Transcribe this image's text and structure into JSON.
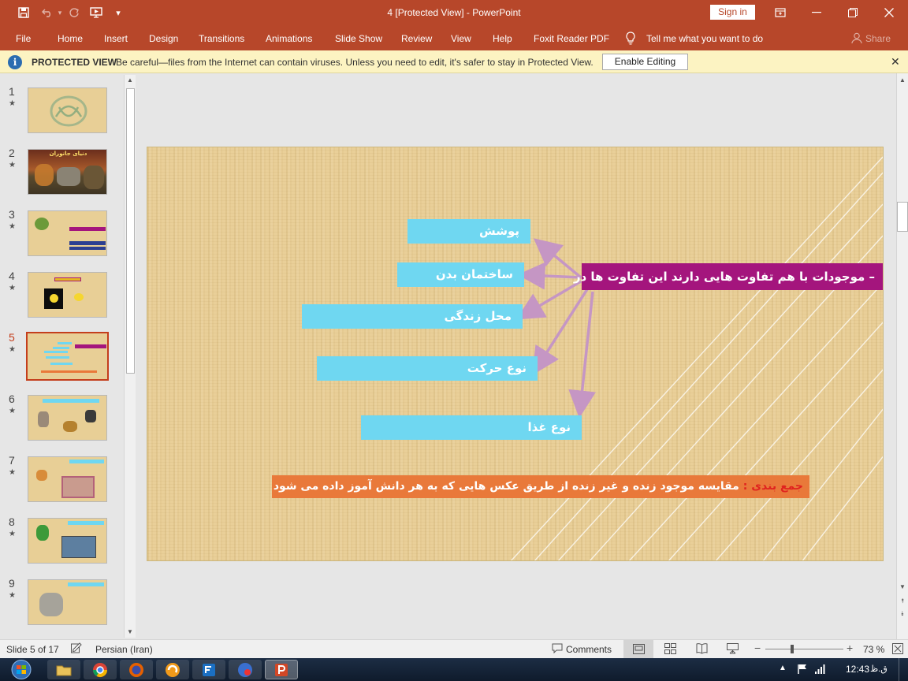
{
  "title_bar": {
    "document_title": "4 [Protected View]  -  PowerPoint",
    "sign_in_label": "Sign in",
    "quick_access": [
      "save-icon",
      "undo-icon",
      "redo-icon",
      "start-from-beginning-icon",
      "customize-qat-icon"
    ]
  },
  "ribbon": {
    "tabs": [
      "File",
      "Home",
      "Insert",
      "Design",
      "Transitions",
      "Animations",
      "Slide Show",
      "Review",
      "View",
      "Help",
      "Foxit Reader PDF"
    ],
    "tell_me": "Tell me what you want to do",
    "share": "Share"
  },
  "protected_view": {
    "title": "PROTECTED VIEW",
    "message": "Be careful—files from the Internet can contain viruses. Unless you need to edit, it's safer to stay in Protected View.",
    "enable_button": "Enable Editing"
  },
  "thumbnails": {
    "numbers": [
      "1",
      "2",
      "3",
      "4",
      "5",
      "6",
      "7",
      "8",
      "9"
    ],
    "star": "★",
    "selected": "5",
    "slide2_title": "دنیای جانوران"
  },
  "slide": {
    "main_text": "– موجودات با هم تفاوت هایی دارند این تفاوت ها در",
    "boxes": [
      "پوشش",
      "ساختمان بدن",
      "محل زندگی",
      "نوع حرکت",
      "نوع غذا"
    ],
    "summary_label": "جمع بندی :",
    "summary_text": "مقایسه موجود زنده و غیر زنده از طریق عکس هایی که به هر دانش آموز داده می شود"
  },
  "status_bar": {
    "slide_info": "Slide 5 of 17",
    "language": "Persian (Iran)",
    "comments": "Comments",
    "zoom": "73 %"
  },
  "taskbar": {
    "time": "12:43",
    "ampm": "ق.ظ"
  },
  "colors": {
    "accent": "#b7472a",
    "slide_bg": "#e9cf98",
    "box_cyan": "#6fd7f1",
    "box_magenta": "#a4157d",
    "box_orange": "#e9793a",
    "arrow": "#c596c4",
    "selection": "#c43e1c"
  }
}
